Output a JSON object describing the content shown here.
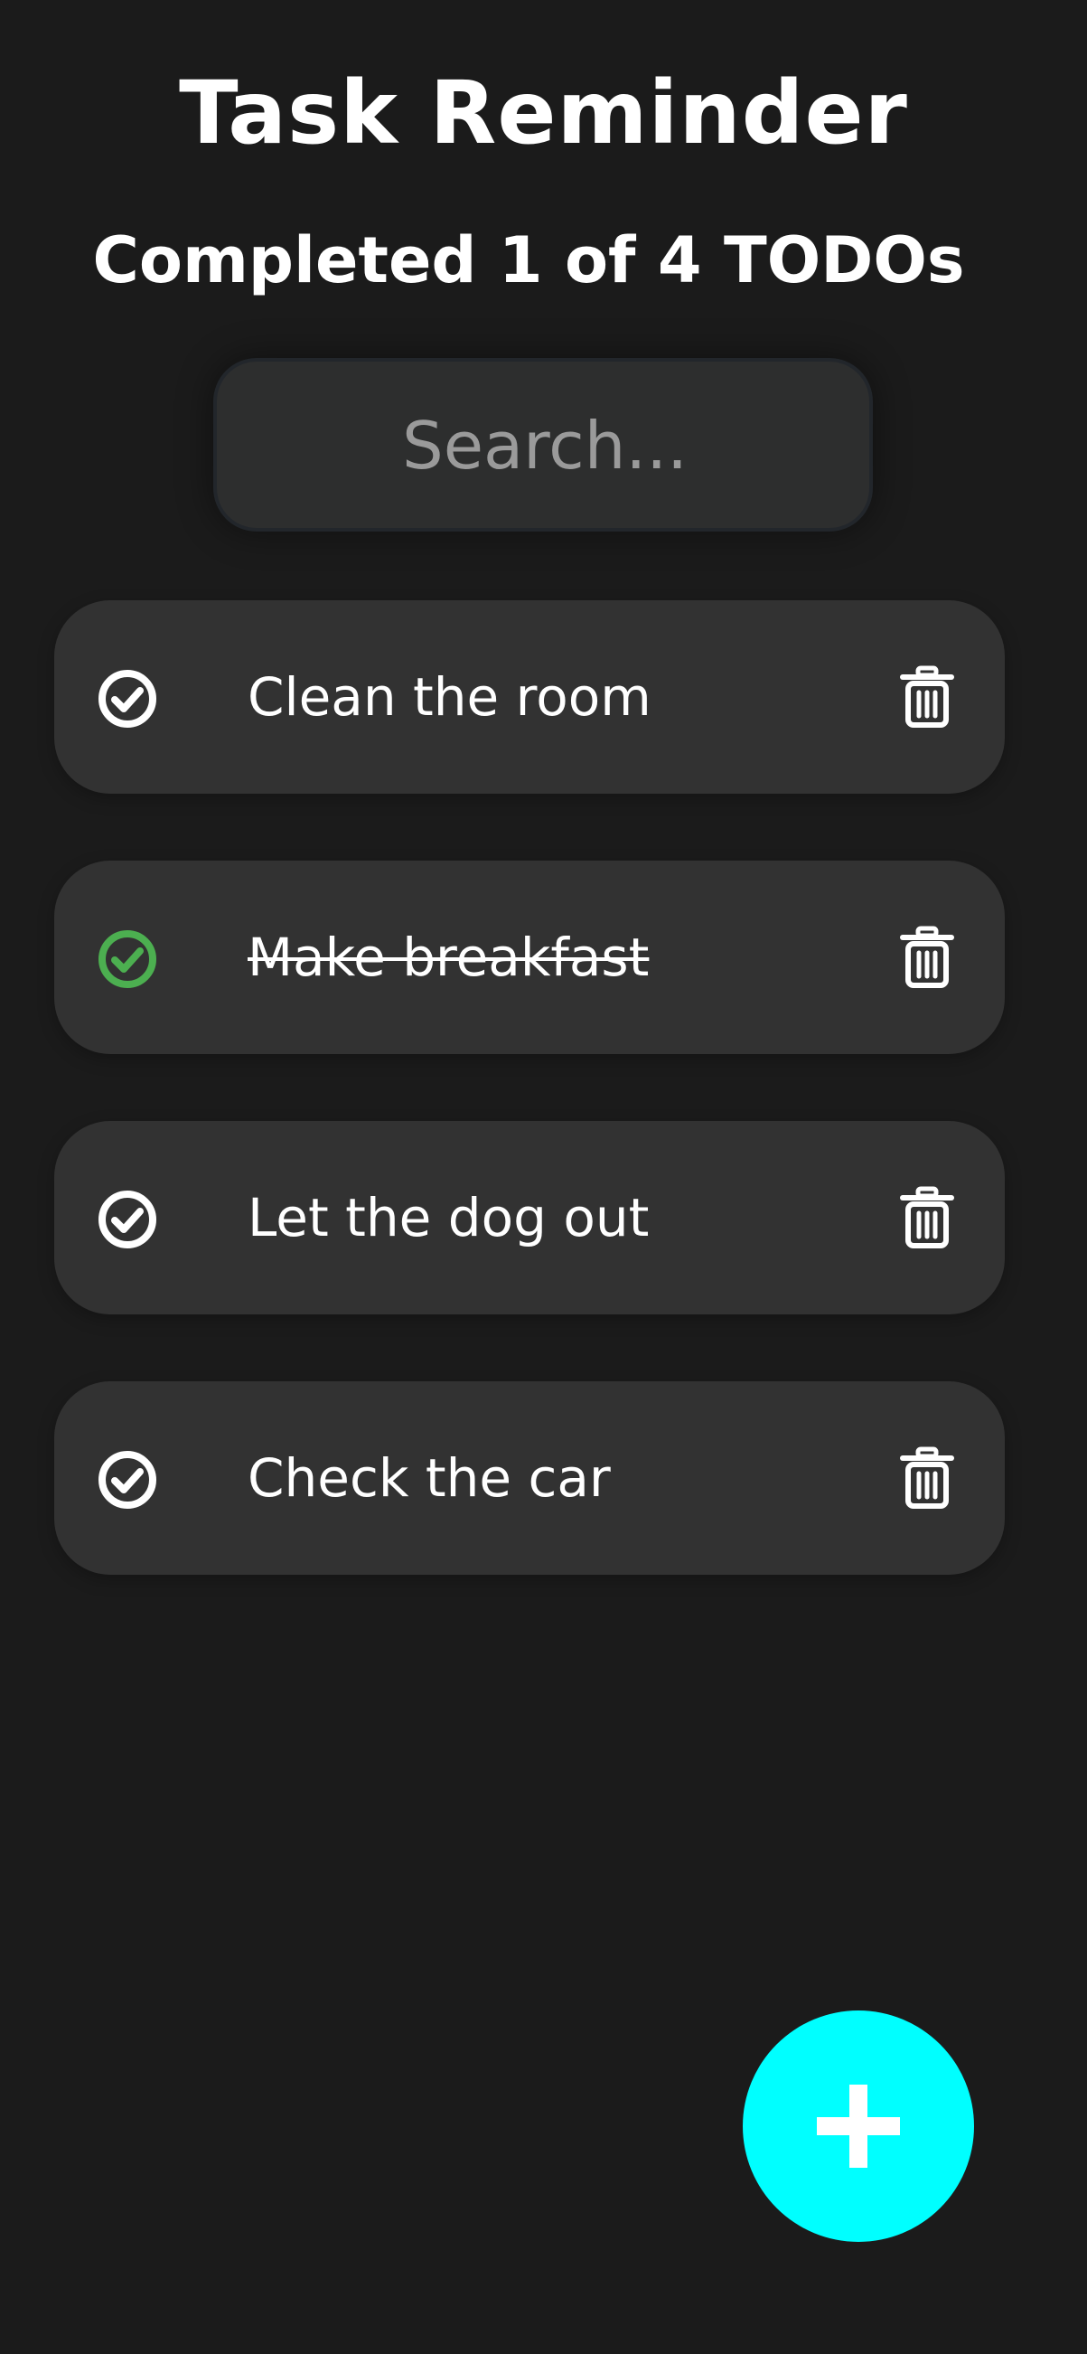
{
  "header": {
    "title": "Task Reminder",
    "subtitle": "Completed 1 of 4 TODOs"
  },
  "search": {
    "placeholder": "Search...",
    "value": ""
  },
  "todos": [
    {
      "text": "Clean the room",
      "completed": false
    },
    {
      "text": "Make breakfast",
      "completed": true
    },
    {
      "text": "Let the dog out",
      "completed": false
    },
    {
      "text": "Check the car",
      "completed": false
    }
  ],
  "icons": {
    "check": "check-circle-icon",
    "delete": "trash-icon",
    "add": "plus-icon"
  },
  "colors": {
    "background": "#1b1b1b",
    "card": "#323232",
    "completed_check": "#4caf50",
    "fab": "#00ffff"
  }
}
